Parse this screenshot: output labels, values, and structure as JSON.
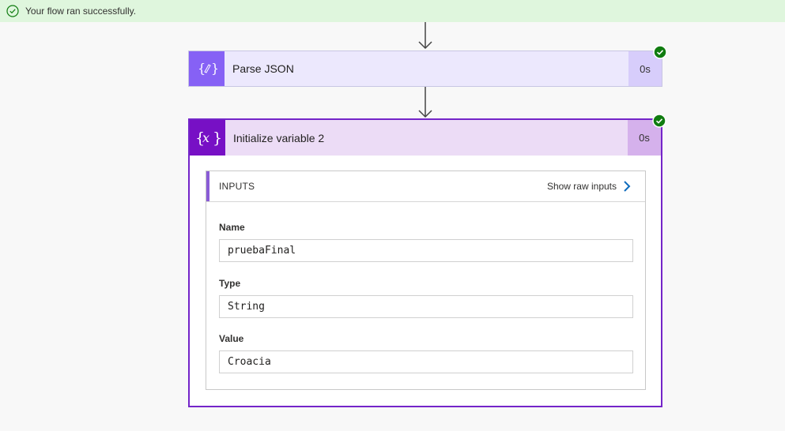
{
  "banner": {
    "message": "Your flow ran successfully."
  },
  "steps": [
    {
      "title": "Parse JSON",
      "duration": "0s",
      "icon": "parse-json-icon",
      "status": "succeeded"
    },
    {
      "title": "Initialize variable 2",
      "duration": "0s",
      "icon": "variable-icon",
      "status": "succeeded"
    }
  ],
  "inputs": {
    "header": "INPUTS",
    "show_raw_label": "Show raw inputs",
    "fields": [
      {
        "label": "Name",
        "value": "pruebaFinal"
      },
      {
        "label": "Type",
        "value": "String"
      },
      {
        "label": "Value",
        "value": "Croacia"
      }
    ]
  },
  "colors": {
    "success": "#107c10",
    "banner_bg": "#dff6dd",
    "parse_json_accent": "#8661f5",
    "variable_accent": "#7710c5"
  }
}
